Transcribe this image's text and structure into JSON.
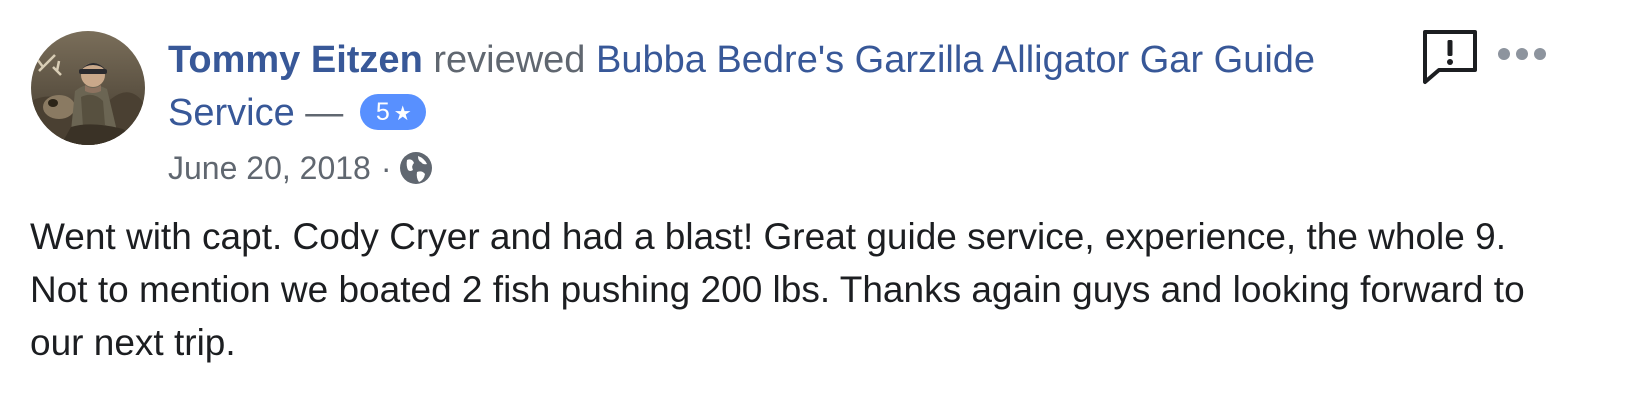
{
  "review": {
    "author": "Tommy Eitzen",
    "action": "reviewed",
    "page_name": "Bubba Bedre's Garzilla Alligator Gar Guide Service",
    "dash": "—",
    "rating": "5",
    "rating_icon": "star-icon",
    "date": "June 20, 2018",
    "separator": "·",
    "privacy_icon": "globe-icon",
    "body": "Went with capt. Cody Cryer and had a blast! Great guide service, experience, the whole 9. Not to mention we boated 2 fish pushing 200 lbs. Thanks again guys and looking forward to our next trip."
  },
  "actions": {
    "report_icon": "report-speech-bubble-icon",
    "more_icon": "more-options-icon"
  },
  "colors": {
    "link": "#385898",
    "secondary_text": "#606770",
    "badge": "#5890ff",
    "body_text": "#1c1e21"
  }
}
